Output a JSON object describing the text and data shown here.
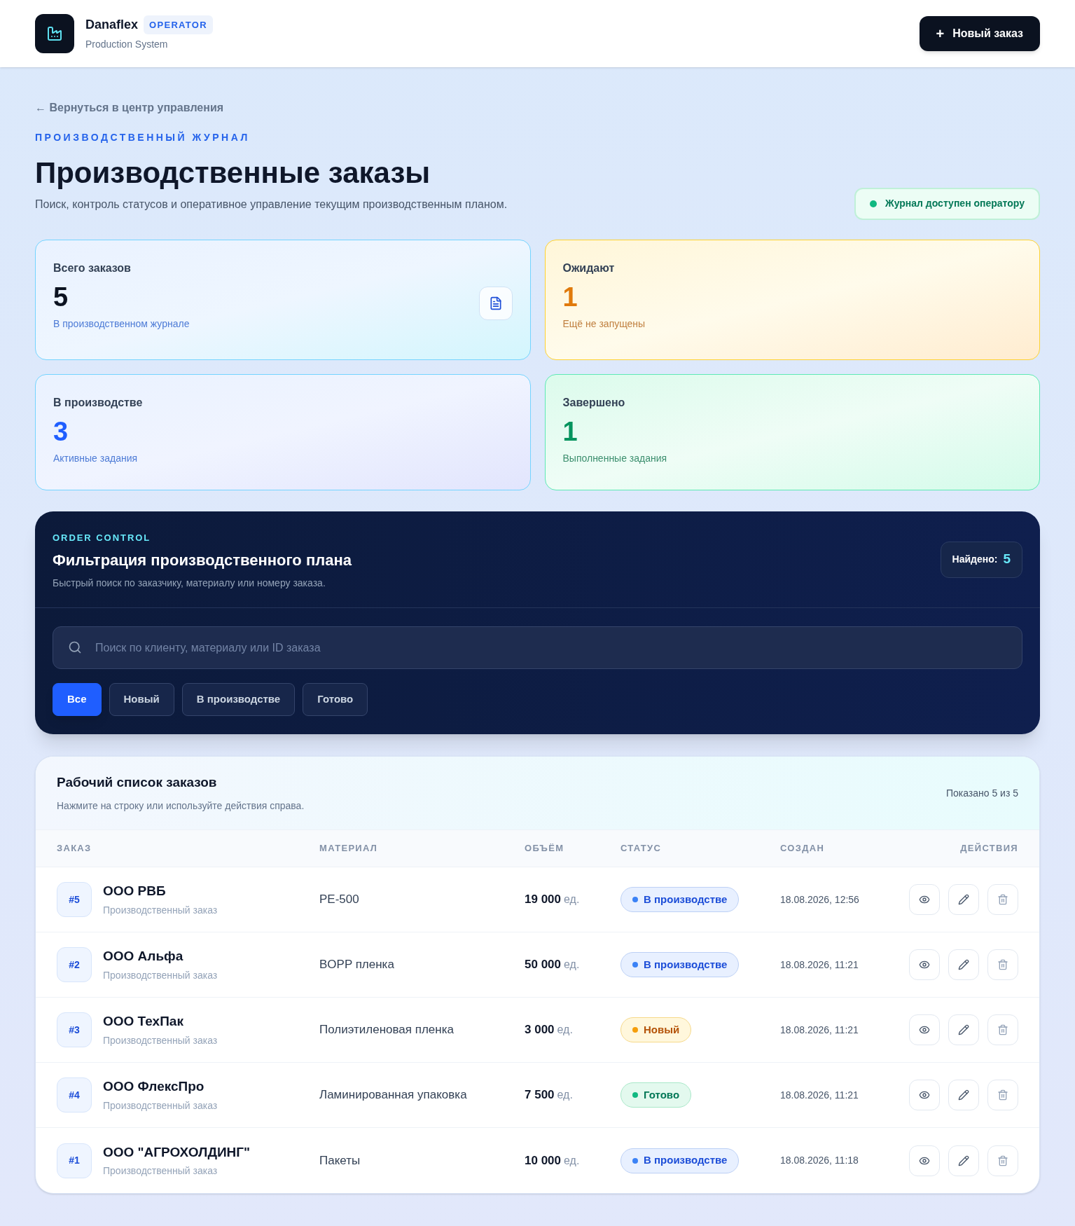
{
  "header": {
    "brand": "Danaflex",
    "role_badge": "OPERATOR",
    "subtitle": "Production System",
    "new_order_button": {
      "icon": "+",
      "label": "Новый заказ"
    }
  },
  "back_link": "← Вернуться в центр управления",
  "eyebrow": "ПРОИЗВОДСТВЕННЫЙ ЖУРНАЛ",
  "title": "Производственные заказы",
  "description": "Поиск, контроль статусов и оперативное управление текущим производственным планом.",
  "access_badge": "Журнал доступен оператору",
  "stats": [
    {
      "kind": "total",
      "label": "Всего заказов",
      "value": "5",
      "caption": "В производственном журнале"
    },
    {
      "kind": "pending",
      "label": "Ожидают",
      "value": "1",
      "caption": "Ещё не запущены"
    },
    {
      "kind": "production",
      "label": "В производстве",
      "value": "3",
      "caption": "Активные задания"
    },
    {
      "kind": "done",
      "label": "Завершено",
      "value": "1",
      "caption": "Выполненные задания"
    }
  ],
  "filter_panel": {
    "eyebrow": "ORDER CONTROL",
    "title": "Фильтрация производственного плана",
    "subtitle": "Быстрый поиск по заказчику, материалу или номеру заказа.",
    "found_label": "Найдено:",
    "found_value": "5",
    "search": {
      "placeholder": "Поиск по клиенту, материалу или ID заказа"
    },
    "filters": [
      {
        "label": "Все",
        "selected": true
      },
      {
        "label": "Новый",
        "selected": false
      },
      {
        "label": "В производстве",
        "selected": false
      },
      {
        "label": "Готово",
        "selected": false
      }
    ]
  },
  "orders": {
    "title": "Рабочий список заказов",
    "subtitle": "Нажмите на строку или используйте действия справа.",
    "shown": "Показано 5 из 5",
    "columns": [
      "ЗАКАЗ",
      "МАТЕРИАЛ",
      "ОБЪЁМ",
      "СТАТУС",
      "СОЗДАН",
      "ДЕЙСТВИЯ"
    ],
    "rows": [
      {
        "id": "#5",
        "customer": "ООО РВБ",
        "type": "Производственный заказ",
        "material": "PE-500",
        "volume": "19 000",
        "unit": "ед.",
        "status": {
          "kind": "production",
          "label": "В производстве"
        },
        "created": "18.08.2026, 12:56"
      },
      {
        "id": "#2",
        "customer": "ООО Альфа",
        "type": "Производственный заказ",
        "material": "BOPP пленка",
        "volume": "50 000",
        "unit": "ед.",
        "status": {
          "kind": "production",
          "label": "В производстве"
        },
        "created": "18.08.2026, 11:21"
      },
      {
        "id": "#3",
        "customer": "ООО ТехПак",
        "type": "Производственный заказ",
        "material": "Полиэтиленовая пленка",
        "volume": "3 000",
        "unit": "ед.",
        "status": {
          "kind": "new",
          "label": "Новый"
        },
        "created": "18.08.2026, 11:21"
      },
      {
        "id": "#4",
        "customer": "ООО ФлексПро",
        "type": "Производственный заказ",
        "material": "Ламинированная упаковка",
        "volume": "7 500",
        "unit": "ед.",
        "status": {
          "kind": "done",
          "label": "Готово"
        },
        "created": "18.08.2026, 11:21"
      },
      {
        "id": "#1",
        "customer": "ООО \"АГРОХОЛДИНГ\"",
        "type": "Производственный заказ",
        "material": "Пакеты",
        "volume": "10 000",
        "unit": "ед.",
        "status": {
          "kind": "production",
          "label": "В производстве"
        },
        "created": "18.08.2026, 11:18"
      }
    ]
  }
}
